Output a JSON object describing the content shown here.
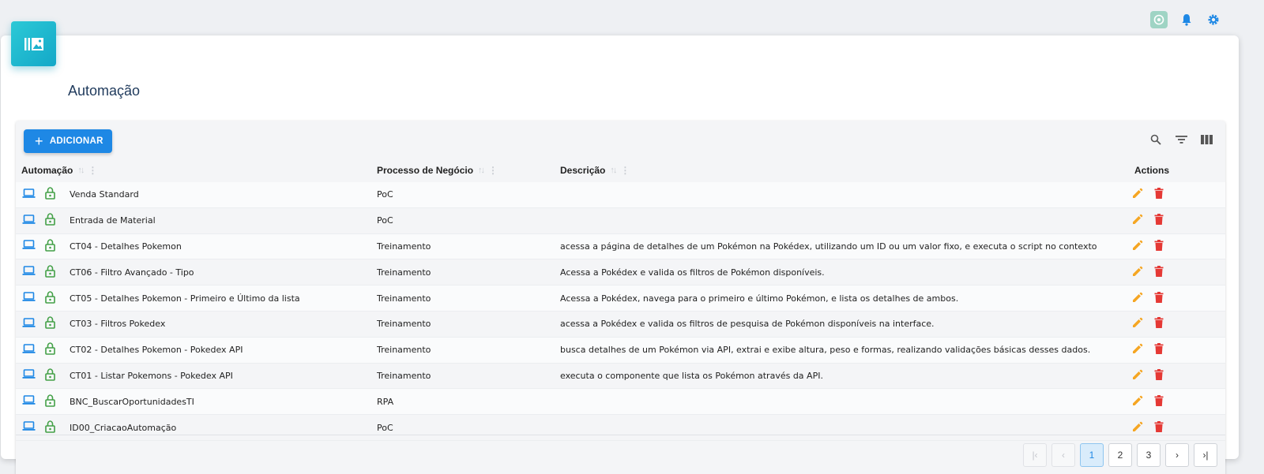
{
  "page": {
    "title": "Automação"
  },
  "toolbar": {
    "add_label": "ADICIONAR"
  },
  "columns": {
    "automacao": "Automação",
    "processo": "Processo de Negócio",
    "descricao": "Descrição",
    "actions": "Actions"
  },
  "rows": [
    {
      "name": "Venda Standard",
      "process": "PoC",
      "description": ""
    },
    {
      "name": "Entrada de Material",
      "process": "PoC",
      "description": ""
    },
    {
      "name": "CT04 - Detalhes Pokemon",
      "process": "Treinamento",
      "description": "acessa a página de detalhes de um Pokémon na Pokédex, utilizando um ID ou um valor fixo, e executa o script no contexto"
    },
    {
      "name": "CT06 - Filtro Avançado - Tipo",
      "process": "Treinamento",
      "description": "Acessa a Pokédex e valida os filtros de Pokémon disponíveis."
    },
    {
      "name": "CT05 - Detalhes Pokemon - Primeiro e Último da lista",
      "process": "Treinamento",
      "description": "Acessa a Pokédex, navega para o primeiro e último Pokémon, e lista os detalhes de ambos."
    },
    {
      "name": "CT03 - Filtros Pokedex",
      "process": "Treinamento",
      "description": "acessa a Pokédex e valida os filtros de pesquisa de Pokémon disponíveis na interface."
    },
    {
      "name": "CT02 - Detalhes Pokemon - Pokedex API",
      "process": "Treinamento",
      "description": "busca detalhes de um Pokémon via API, extrai e exibe altura, peso e formas, realizando validações básicas desses dados."
    },
    {
      "name": "CT01 - Listar Pokemons - Pokedex API",
      "process": "Treinamento",
      "description": "executa o componente que lista os Pokémon através da API."
    },
    {
      "name": "BNC_BuscarOportunidadesTI",
      "process": "RPA",
      "description": ""
    },
    {
      "name": "ID00_CriacaoAutomação",
      "process": "PoC",
      "description": ""
    }
  ],
  "pagination": {
    "pages": [
      "1",
      "2",
      "3"
    ],
    "current": "1",
    "first_icon": "first-page-icon",
    "prev_icon": "prev-page-icon",
    "next_icon": "next-page-icon",
    "last_icon": "last-page-icon"
  },
  "colors": {
    "accent": "#1e88e5",
    "logo": "#13a8c8",
    "edit": "#f5a623",
    "delete": "#e53935",
    "lock": "#43a047",
    "laptop": "#1e88e5"
  },
  "icons": [
    "ai-assistant-icon",
    "bell-icon",
    "gear-icon",
    "search-icon",
    "filter-icon",
    "columns-icon"
  ]
}
